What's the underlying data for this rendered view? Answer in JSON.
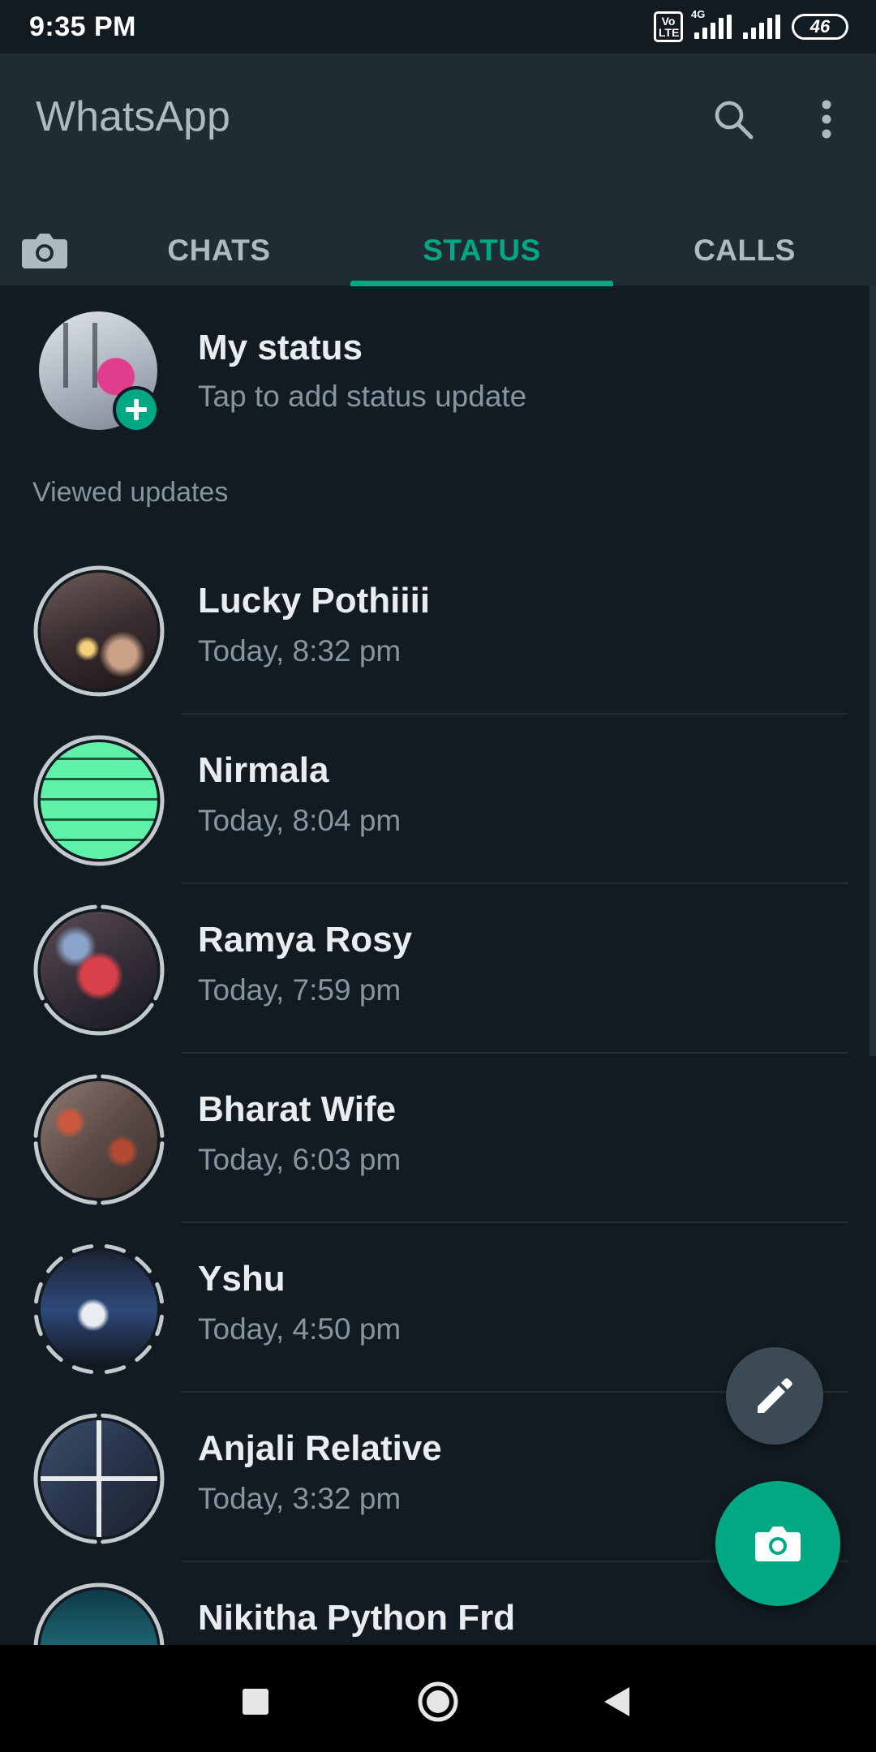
{
  "status_bar": {
    "time": "9:35 PM",
    "volte": "Vo LTE",
    "network": "4G",
    "battery": "46"
  },
  "app": {
    "title": "WhatsApp"
  },
  "tabs": [
    {
      "label": "CHATS",
      "active": false
    },
    {
      "label": "STATUS",
      "active": true
    },
    {
      "label": "CALLS",
      "active": false
    }
  ],
  "my_status": {
    "name": "My status",
    "subtitle": "Tap to add status update"
  },
  "section_label": "Viewed updates",
  "statuses": [
    {
      "name": "Lucky Pothiiii",
      "time": "Today, 8:32 pm",
      "segments": 1
    },
    {
      "name": "Nirmala",
      "time": "Today, 8:04 pm",
      "segments": 1
    },
    {
      "name": "Ramya Rosy",
      "time": "Today, 7:59 pm",
      "segments": 3
    },
    {
      "name": "Bharat Wife",
      "time": "Today, 6:03 pm",
      "segments": 4
    },
    {
      "name": "Yshu",
      "time": "Today, 4:50 pm",
      "segments": 12
    },
    {
      "name": "Anjali Relative",
      "time": "Today, 3:32 pm",
      "segments": 2
    },
    {
      "name": "Nikitha Python Frd",
      "time": "",
      "segments": 1
    }
  ],
  "colors": {
    "accent": "#00a884",
    "background": "#121b22",
    "appbar": "#202c33",
    "secondary_text": "#8696a0",
    "viewed_ring": "#c4c9cc"
  },
  "icons": {
    "search": "search-icon",
    "more": "more-vert-icon",
    "camera": "camera-icon",
    "add": "add-icon",
    "pencil": "pencil-icon"
  }
}
